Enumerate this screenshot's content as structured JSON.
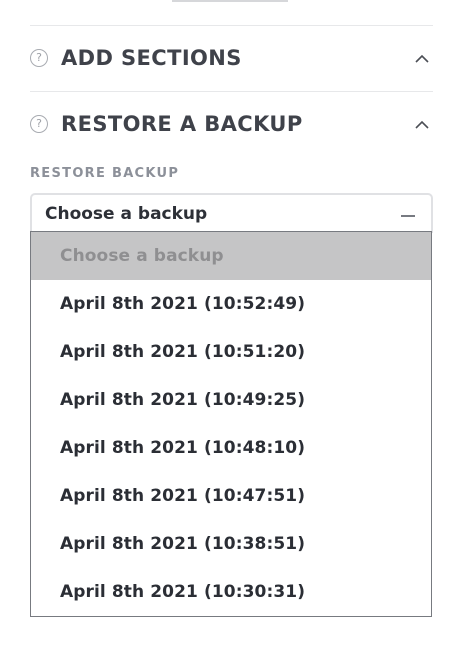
{
  "sections": [
    {
      "title": "ADD SECTIONS"
    },
    {
      "title": "RESTORE A BACKUP"
    }
  ],
  "restore": {
    "label": "RESTORE BACKUP",
    "selected_value": "Choose a backup",
    "options": [
      "Choose a backup",
      "April 8th 2021 (10:52:49)",
      "April 8th 2021 (10:51:20)",
      "April 8th 2021 (10:49:25)",
      "April 8th 2021 (10:48:10)",
      "April 8th 2021 (10:47:51)",
      "April 8th 2021 (10:38:51)",
      "April 8th 2021 (10:30:31)"
    ]
  },
  "icons": {
    "help": "help-circle-icon",
    "collapse": "chevron-up-icon",
    "select_toggle": "minus-icon"
  },
  "colors": {
    "text": "#2b2d33",
    "muted_label": "#8c9099",
    "divider": "#e7e8ea",
    "placeholder_highlight": "#c5c5c6"
  }
}
